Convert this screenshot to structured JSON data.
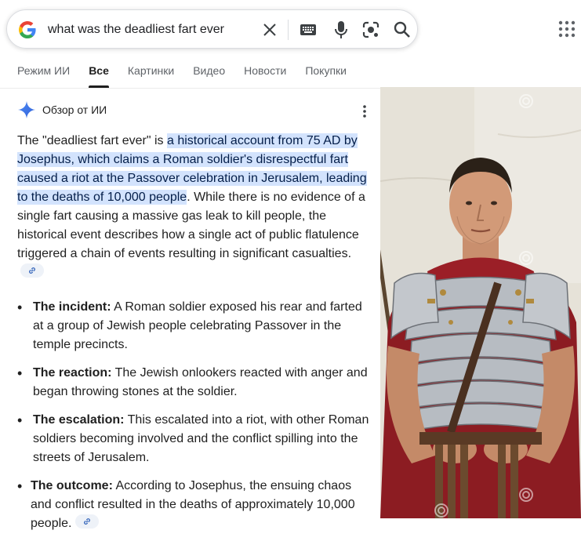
{
  "search": {
    "query": "what was the deadliest fart ever"
  },
  "tabs": [
    {
      "label": "Режим ИИ",
      "active": false
    },
    {
      "label": "Все",
      "active": true
    },
    {
      "label": "Картинки",
      "active": false
    },
    {
      "label": "Видео",
      "active": false
    },
    {
      "label": "Новости",
      "active": false
    },
    {
      "label": "Покупки",
      "active": false
    }
  ],
  "ai_overview": {
    "title": "Обзор от ИИ",
    "intro_plain": "The \"deadliest fart ever\" is ",
    "intro_highlight": "a historical account from 75 AD by Josephus, which claims a Roman soldier's disrespectful fart caused a riot at the Passover celebration in Jerusalem, leading to the deaths of 10,000 people",
    "intro_rest": ". While there is no evidence of a single fart causing a massive gas leak to kill people, the historical event describes how a single act of public flatulence triggered a chain of events resulting in significant casualties.",
    "bullets": [
      {
        "heading": "The incident:",
        "text": " A Roman soldier exposed his rear and farted at a group of Jewish people celebrating Passover in the temple precincts."
      },
      {
        "heading": "The reaction:",
        "text": " The Jewish onlookers reacted with anger and began throwing stones at the soldier."
      },
      {
        "heading": "The escalation:",
        "text": " This escalated into a riot, with other Roman soldiers becoming involved and the conflict spilling into the streets of Jerusalem."
      },
      {
        "heading": "The outcome:",
        "text": " According to Josephus, the ensuing chaos and conflict resulted in the deaths of approximately 10,000 people."
      }
    ]
  },
  "colors": {
    "highlight_bg": "#d3e3fd",
    "sparkle": "#4285f4"
  },
  "icons": [
    "google-logo-icon",
    "clear-icon",
    "keyboard-icon",
    "mic-icon",
    "lens-icon",
    "search-icon",
    "apps-grid-icon",
    "sparkle-icon",
    "more-vert-icon",
    "link-icon"
  ]
}
